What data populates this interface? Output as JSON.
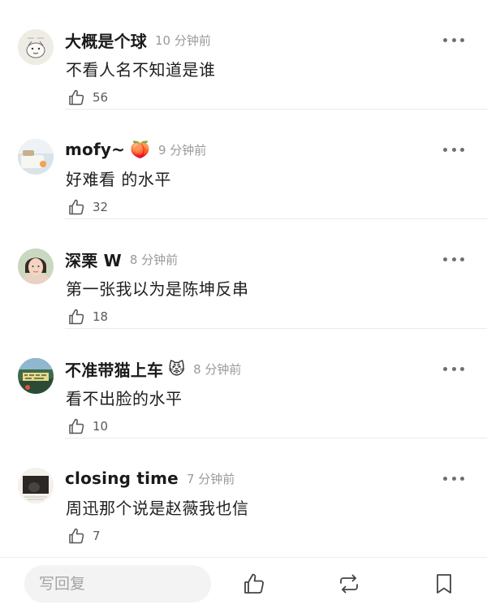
{
  "colors": {
    "text": "#1f1f1f",
    "secondary": "#9a9a9a",
    "icon": "#555555",
    "divider": "#ebebeb",
    "input_bg": "#f3f3f3"
  },
  "comments": [
    {
      "username": "大概是个球",
      "name_emoji": "",
      "time": "10 分钟前",
      "text": "不看人名不知道是谁",
      "likes": "56",
      "avatar": "sketch-avatar"
    },
    {
      "username": "mofy~",
      "name_emoji": "🍑",
      "time": "9 分钟前",
      "text": "好难看 的水平",
      "likes": "32",
      "avatar": "bed-photo-avatar"
    },
    {
      "username": "深栗 W",
      "name_emoji": "",
      "time": "8 分钟前",
      "text": "第一张我以为是陈坤反串",
      "likes": "18",
      "avatar": "portrait-avatar"
    },
    {
      "username": "不准带猫上车",
      "name_emoji": "😾",
      "time": "8 分钟前",
      "text": "看不出脸的水平",
      "likes": "10",
      "avatar": "poster-avatar"
    },
    {
      "username": "closing time",
      "name_emoji": "",
      "time": "7 分钟前",
      "text": "周迅那个说是赵薇我也信",
      "likes": "7",
      "avatar": "dark-photo-avatar"
    }
  ],
  "bottom_bar": {
    "reply_placeholder": "写回复",
    "icons": [
      "thumbs-up-icon",
      "repost-icon",
      "bookmark-icon"
    ]
  }
}
